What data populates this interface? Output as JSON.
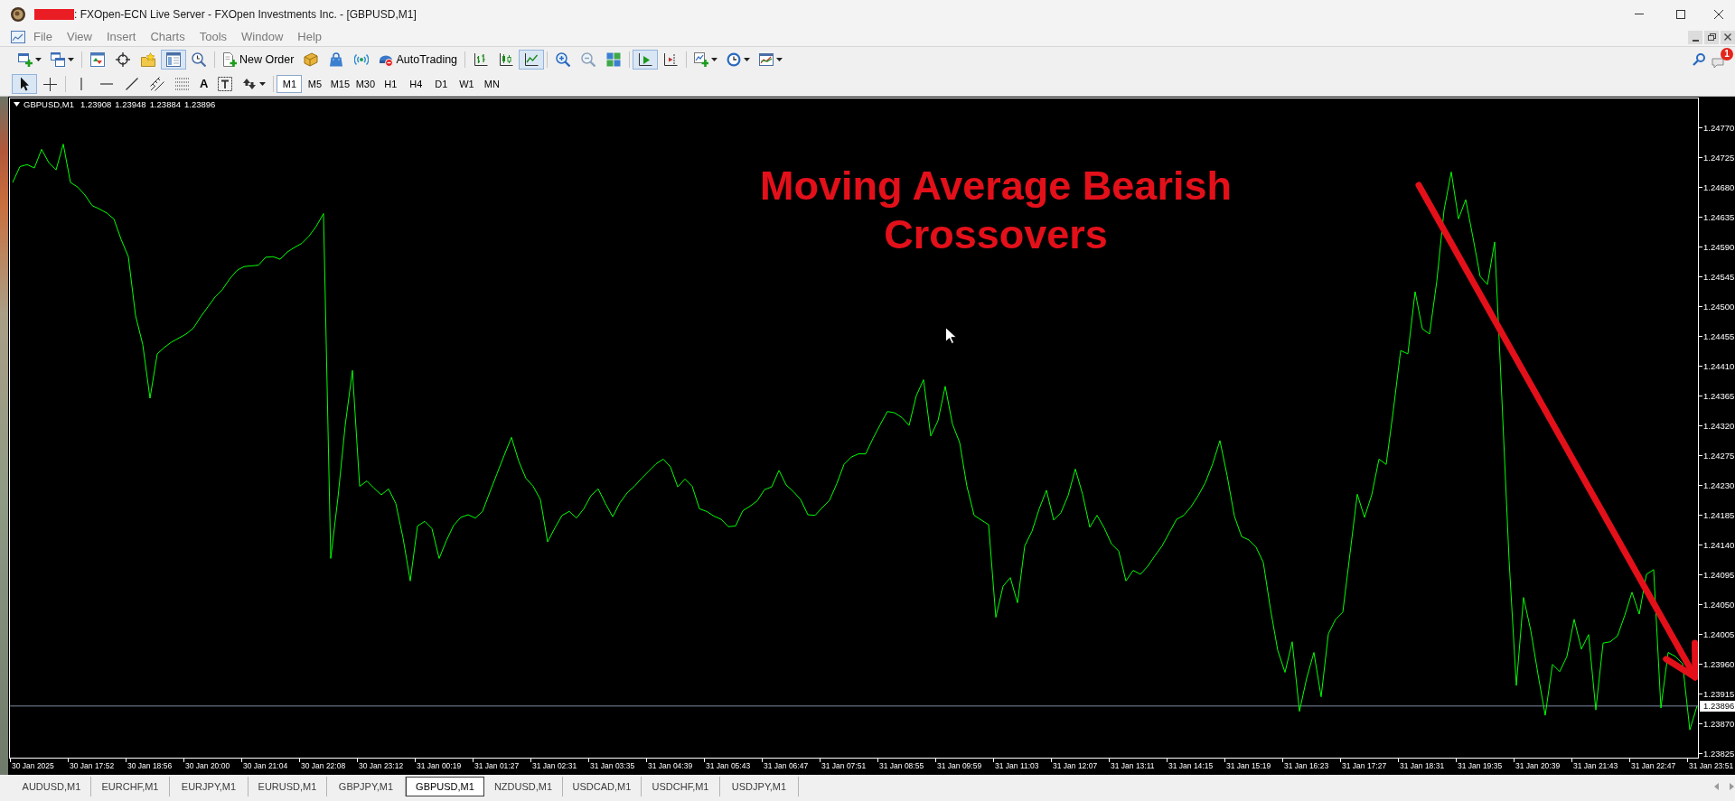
{
  "window": {
    "title": ": FXOpen-ECN Live Server - FXOpen Investments Inc. - [GBPUSD,M1]"
  },
  "menu": {
    "inactive": true,
    "items": [
      "File",
      "View",
      "Insert",
      "Charts",
      "Tools",
      "Window",
      "Help"
    ]
  },
  "toolbar": {
    "groups": [
      [
        {
          "pressed": false,
          "dropdown": true
        },
        {
          "pressed": false,
          "dropdown": true
        }
      ],
      [
        {
          "pressed": false
        },
        {
          "pressed": false
        },
        {
          "pressed": false
        },
        {
          "pressed": true
        },
        {
          "pressed": false
        }
      ],
      [
        {
          "pressed": false,
          "label": "New Order"
        },
        {
          "pressed": false
        },
        {
          "pressed": false
        },
        {
          "pressed": false
        },
        {
          "pressed": false,
          "label": "AutoTrading"
        }
      ],
      [
        {
          "pressed": false
        },
        {
          "pressed": false
        },
        {
          "pressed": true
        }
      ],
      [
        {
          "pressed": false
        },
        {
          "pressed": false
        },
        {
          "pressed": false
        }
      ],
      [
        {
          "pressed": true
        },
        {
          "pressed": false
        }
      ],
      [
        {
          "pressed": false,
          "dropdown": true
        },
        {
          "pressed": false,
          "dropdown": true
        },
        {
          "pressed": false,
          "dropdown": true
        }
      ]
    ]
  },
  "notifications": {
    "badge": "1"
  },
  "drawing_tools": {
    "groups": [
      [
        {
          "pressed": true
        },
        {
          "pressed": false
        }
      ],
      [
        {
          "pressed": false
        },
        {
          "pressed": false
        },
        {
          "pressed": false
        },
        {
          "pressed": false
        },
        {
          "pressed": false
        },
        {
          "pressed": false,
          "label": "A"
        },
        {
          "pressed": false
        },
        {
          "pressed": false,
          "dropdown": true
        }
      ]
    ]
  },
  "timeframes": [
    {
      "label": "M1",
      "selected": true
    },
    {
      "label": "M5",
      "selected": false
    },
    {
      "label": "M15",
      "selected": false
    },
    {
      "label": "M30",
      "selected": false
    },
    {
      "label": "H1",
      "selected": false
    },
    {
      "label": "H4",
      "selected": false
    },
    {
      "label": "D1",
      "selected": false
    },
    {
      "label": "W1",
      "selected": false
    },
    {
      "label": "MN",
      "selected": false
    }
  ],
  "chart": {
    "header": {
      "quotes": [
        "1.23908",
        "1.23948",
        "1.23884",
        "1.23896"
      ]
    },
    "chart_data": {
      "type": "line",
      "title": "GBPUSD,M1",
      "categories": [
        null,
        null,
        null,
        "30 Jan 2025",
        null,
        null,
        null,
        null,
        null,
        null,
        null,
        "30 Jan 17:52",
        null,
        null,
        null,
        null,
        null,
        null,
        null,
        "30 Jan 18:56",
        null,
        null,
        null,
        null,
        null,
        null,
        null,
        "30 Jan 20:00",
        null,
        null,
        null,
        null,
        null,
        null,
        null,
        "30 Jan 21:04",
        null,
        null,
        null,
        null,
        null,
        null,
        null,
        "30 Jan 22:08",
        null,
        null,
        null,
        null,
        null,
        null,
        null,
        "30 Jan 23:12",
        null,
        null,
        null,
        null,
        null,
        null,
        null,
        "31 Jan 00:19",
        null,
        null,
        null,
        null,
        null,
        null,
        null,
        "31 Jan 01:27",
        null,
        null,
        null,
        null,
        null,
        null,
        null,
        "31 Jan 02:31",
        null,
        null,
        null,
        null,
        null,
        null,
        null,
        "31 Jan 03:35",
        null,
        null,
        null,
        null,
        null,
        null,
        null,
        "31 Jan 04:39",
        null,
        null,
        null,
        null,
        null,
        null,
        null,
        "31 Jan 05:43",
        null,
        null,
        null,
        null,
        null,
        null,
        null,
        "31 Jan 06:47",
        null,
        null,
        null,
        null,
        null,
        null,
        null,
        "31 Jan 07:51",
        null,
        null,
        null,
        null,
        null,
        null,
        null,
        "31 Jan 08:55",
        null,
        null,
        null,
        null,
        null,
        null,
        null,
        "31 Jan 09:59",
        null,
        null,
        null,
        null,
        null,
        null,
        null,
        "31 Jan 11:03",
        null,
        null,
        null,
        null,
        null,
        null,
        null,
        "31 Jan 12:07",
        null,
        null,
        null,
        null,
        null,
        null,
        null,
        "31 Jan 13:11",
        null,
        null,
        null,
        null,
        null,
        null,
        null,
        "31 Jan 14:15",
        null,
        null,
        null,
        null,
        null,
        null,
        null,
        "31 Jan 15:19",
        null,
        null,
        null,
        null,
        null,
        null,
        null,
        "31 Jan 16:23",
        null,
        null,
        null,
        null,
        null,
        null,
        null,
        "31 Jan 17:27",
        null,
        null,
        null,
        null,
        null,
        null,
        null,
        "31 Jan 18:31",
        null,
        null,
        null,
        null,
        null,
        null,
        null,
        "31 Jan 19:35",
        null,
        null,
        null,
        null,
        null,
        null,
        null,
        "31 Jan 20:39",
        null,
        null,
        null,
        null,
        null,
        null,
        null,
        "31 Jan 21:43",
        null,
        null,
        null,
        null,
        null,
        null,
        null,
        "31 Jan 22:47",
        null,
        null,
        null,
        null,
        null,
        null,
        null,
        "31 Jan 23:51"
      ],
      "series": [
        {
          "color": "#00ff00",
          "values": [
            1.24687,
            1.24711,
            1.24714,
            1.24709,
            1.24737,
            1.24717,
            1.24706,
            1.24745,
            1.24687,
            1.2468,
            1.24668,
            1.24652,
            1.24647,
            1.24641,
            1.24632,
            1.24601,
            1.24575,
            1.24486,
            1.24442,
            1.24361,
            1.24428,
            1.24438,
            1.24446,
            1.24452,
            1.24458,
            1.24467,
            1.24484,
            1.24499,
            1.24514,
            1.24525,
            1.24541,
            1.24554,
            1.2456,
            1.24561,
            1.24562,
            1.24574,
            1.24575,
            1.24571,
            1.24582,
            1.24589,
            1.24595,
            1.24606,
            1.24621,
            1.2464,
            1.24119,
            1.24211,
            1.2432,
            1.24403,
            1.24228,
            1.24236,
            1.24225,
            1.24215,
            1.24224,
            1.24202,
            1.2415,
            1.24085,
            1.24168,
            1.24175,
            1.24164,
            1.24119,
            1.24146,
            1.24169,
            1.24181,
            1.24185,
            1.2418,
            1.2419,
            1.24219,
            1.24247,
            1.24275,
            1.24302,
            1.24266,
            1.2424,
            1.24228,
            1.24208,
            1.24144,
            1.24165,
            1.24184,
            1.2419,
            1.2418,
            1.24194,
            1.24214,
            1.24224,
            1.24202,
            1.24182,
            1.24203,
            1.24218,
            1.24228,
            1.2424,
            1.24251,
            1.24262,
            1.24269,
            1.24257,
            1.24227,
            1.24239,
            1.24228,
            1.24194,
            1.2419,
            1.24183,
            1.24178,
            1.24167,
            1.24168,
            1.24191,
            1.24198,
            1.24206,
            1.24223,
            1.24227,
            1.24252,
            1.2423,
            1.2422,
            1.24208,
            1.24185,
            1.24184,
            1.24196,
            1.24207,
            1.24232,
            1.24261,
            1.24272,
            1.24277,
            1.24277,
            1.243,
            1.24321,
            1.24341,
            1.24339,
            1.24332,
            1.2432,
            1.24365,
            1.24389,
            1.24304,
            1.24327,
            1.24379,
            1.24322,
            1.24294,
            1.24228,
            1.24184,
            1.24177,
            1.2417,
            1.2403,
            1.24077,
            1.2409,
            1.24052,
            1.24138,
            1.2416,
            1.24194,
            1.24222,
            1.24177,
            1.24188,
            1.24214,
            1.24254,
            1.24216,
            1.24166,
            1.24184,
            1.24165,
            1.24141,
            1.2413,
            1.24085,
            1.24101,
            1.24095,
            1.24107,
            1.24123,
            1.24138,
            1.24158,
            1.24178,
            1.24184,
            1.24197,
            1.24214,
            1.24234,
            1.24262,
            1.24297,
            1.24244,
            1.24183,
            1.24152,
            1.24147,
            1.24136,
            1.24113,
            1.24042,
            1.2398,
            1.23947,
            1.23993,
            1.23888,
            1.23938,
            1.23977,
            1.2391,
            1.24005,
            1.24027,
            1.24038,
            1.24127,
            1.24216,
            1.24181,
            1.24215,
            1.24269,
            1.24261,
            1.24344,
            1.24433,
            1.24428,
            1.24522,
            1.24466,
            1.24458,
            1.24538,
            1.24645,
            1.24703,
            1.24632,
            1.24661,
            1.24604,
            1.24545,
            1.24533,
            1.24597,
            1.24361,
            1.24116,
            1.23927,
            1.2406,
            1.2401,
            1.23944,
            1.23882,
            1.23959,
            1.23948,
            1.23971,
            1.24027,
            1.23982,
            1.24004,
            1.2389,
            1.23991,
            1.23993,
            1.24002,
            1.24033,
            1.24068,
            1.24035,
            1.24095,
            1.24102,
            1.23893,
            1.23977,
            1.23971,
            1.2396,
            1.2386,
            1.23896,
            null,
            null
          ]
        }
      ],
      "ylim": [
        1.23818,
        1.24814
      ],
      "yticks": [
        {
          "value": 1.2477,
          "label": "1.24770"
        },
        {
          "value": 1.24725,
          "label": "1.24725"
        },
        {
          "value": 1.2468,
          "label": "1.24680"
        },
        {
          "value": 1.24635,
          "label": "1.24635"
        },
        {
          "value": 1.2459,
          "label": "1.24590"
        },
        {
          "value": 1.24545,
          "label": "1.24545"
        },
        {
          "value": 1.245,
          "label": "1.24500"
        },
        {
          "value": 1.24455,
          "label": "1.24455"
        },
        {
          "value": 1.2441,
          "label": "1.24410"
        },
        {
          "value": 1.24365,
          "label": "1.24365"
        },
        {
          "value": 1.2432,
          "label": "1.24320"
        },
        {
          "value": 1.24275,
          "label": "1.24275"
        },
        {
          "value": 1.2423,
          "label": "1.24230"
        },
        {
          "value": 1.24185,
          "label": "1.24185"
        },
        {
          "value": 1.2414,
          "label": "1.24140"
        },
        {
          "value": 1.24095,
          "label": "1.24095"
        },
        {
          "value": 1.2405,
          "label": "1.24050"
        },
        {
          "value": 1.24005,
          "label": "1.24005"
        },
        {
          "value": 1.2396,
          "label": "1.23960"
        },
        {
          "value": 1.23915,
          "label": "1.23915"
        },
        {
          "value": 1.2387,
          "label": "1.23870"
        },
        {
          "value": 1.23825,
          "label": "1.23825"
        }
      ],
      "ref_lines": [
        {
          "axis": "y",
          "value": 1.23896,
          "label": "1.23896"
        }
      ],
      "annotations": [
        "Moving Average Bearish Crossovers"
      ]
    }
  },
  "tabs": [
    {
      "label": "AUDUSD,M1",
      "selected": false
    },
    {
      "label": "EURCHF,M1",
      "selected": false
    },
    {
      "label": "EURJPY,M1",
      "selected": false
    },
    {
      "label": "EURUSD,M1",
      "selected": false
    },
    {
      "label": "GBPJPY,M1",
      "selected": false
    },
    {
      "label": "GBPUSD,M1",
      "selected": true
    },
    {
      "label": "NZDUSD,M1",
      "selected": false
    },
    {
      "label": "USDCAD,M1",
      "selected": false
    },
    {
      "label": "USDCHF,M1",
      "selected": false
    },
    {
      "label": "USDJPY,M1",
      "selected": false
    }
  ]
}
